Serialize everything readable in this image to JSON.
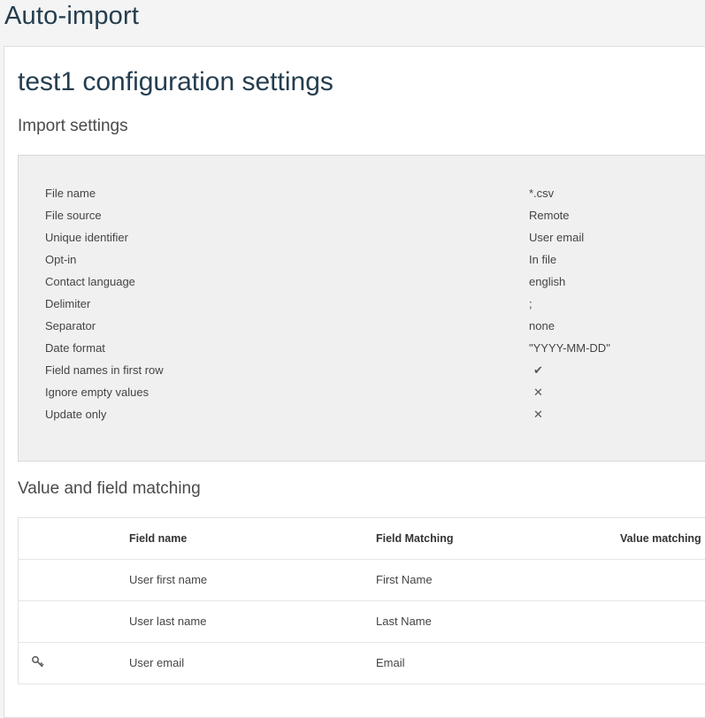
{
  "page": {
    "title": "Auto-import"
  },
  "config": {
    "title": "test1 configuration settings"
  },
  "import_settings": {
    "title": "Import settings",
    "rows": [
      {
        "label": "File name",
        "value": "*.csv"
      },
      {
        "label": "File source",
        "value": "Remote"
      },
      {
        "label": "Unique identifier",
        "value": "User email"
      },
      {
        "label": "Opt-in",
        "value": "In file"
      },
      {
        "label": "Contact language",
        "value": "english"
      },
      {
        "label": "Delimiter",
        "value": ";"
      },
      {
        "label": "Separator",
        "value": "none"
      },
      {
        "label": "Date format",
        "value": "\"YYYY-MM-DD\""
      },
      {
        "label": "Field names in first row",
        "icon": "checkmark-icon",
        "glyph": "✔"
      },
      {
        "label": "Ignore empty values",
        "icon": "cross-icon",
        "glyph": "✕"
      },
      {
        "label": "Update only",
        "icon": "cross-icon",
        "glyph": "✕"
      }
    ]
  },
  "matching": {
    "title": "Value and field matching",
    "headers": {
      "field_name": "Field name",
      "field_matching": "Field Matching",
      "value_matching": "Value matching"
    },
    "rows": [
      {
        "field_name": "User first name",
        "field_matching": "First Name",
        "key": false
      },
      {
        "field_name": "User last name",
        "field_matching": "Last Name",
        "key": false
      },
      {
        "field_name": "User email",
        "field_matching": "Email",
        "key": true,
        "key_icon": "key-icon"
      }
    ]
  },
  "colors": {
    "title": "#243d4f",
    "panel_bg": "#f0f0f0",
    "page_bg": "#f4f4f4"
  }
}
